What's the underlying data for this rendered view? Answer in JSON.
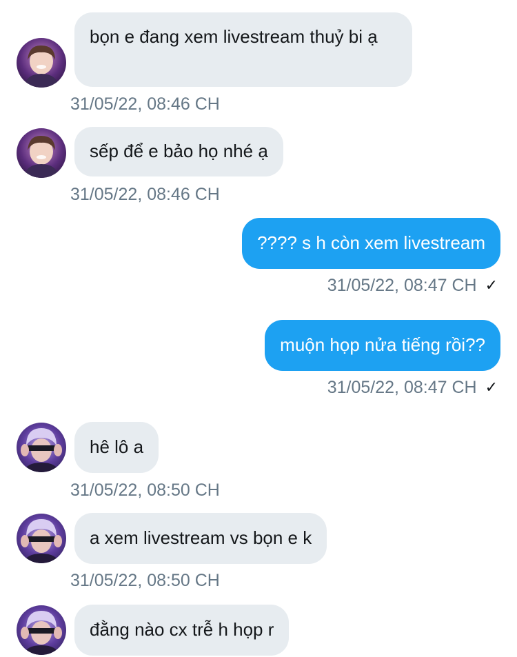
{
  "messages": [
    {
      "direction": "in",
      "avatar": "avatar-user-1",
      "text": "bọn e đang xem livestream thuỷ bi ạ",
      "timestamp": "31/05/22, 08:46 CH"
    },
    {
      "direction": "in",
      "avatar": "avatar-user-1",
      "text": "sếp để e bảo họ nhé ạ",
      "timestamp": "31/05/22, 08:46 CH"
    },
    {
      "direction": "out",
      "text": "???? s h còn xem livestream",
      "timestamp": "31/05/22, 08:47 CH",
      "status_icon": "checkmark-icon"
    },
    {
      "direction": "out",
      "text": "muộn họp nửa tiếng rồi??",
      "timestamp": "31/05/22, 08:47 CH",
      "status_icon": "checkmark-icon"
    },
    {
      "direction": "in",
      "avatar": "avatar-user-2",
      "text": "hê lô a",
      "timestamp": "31/05/22, 08:50 CH"
    },
    {
      "direction": "in",
      "avatar": "avatar-user-2",
      "text": "a xem livestream vs bọn e k",
      "timestamp": "31/05/22, 08:50 CH"
    },
    {
      "direction": "in",
      "avatar": "avatar-user-2",
      "text": "đằng nào cx trễ h họp r"
    }
  ],
  "colors": {
    "incoming_bubble": "#e7ecf0",
    "outgoing_bubble": "#1da1f2",
    "timestamp_text": "#657786",
    "message_text": "#14171a"
  }
}
